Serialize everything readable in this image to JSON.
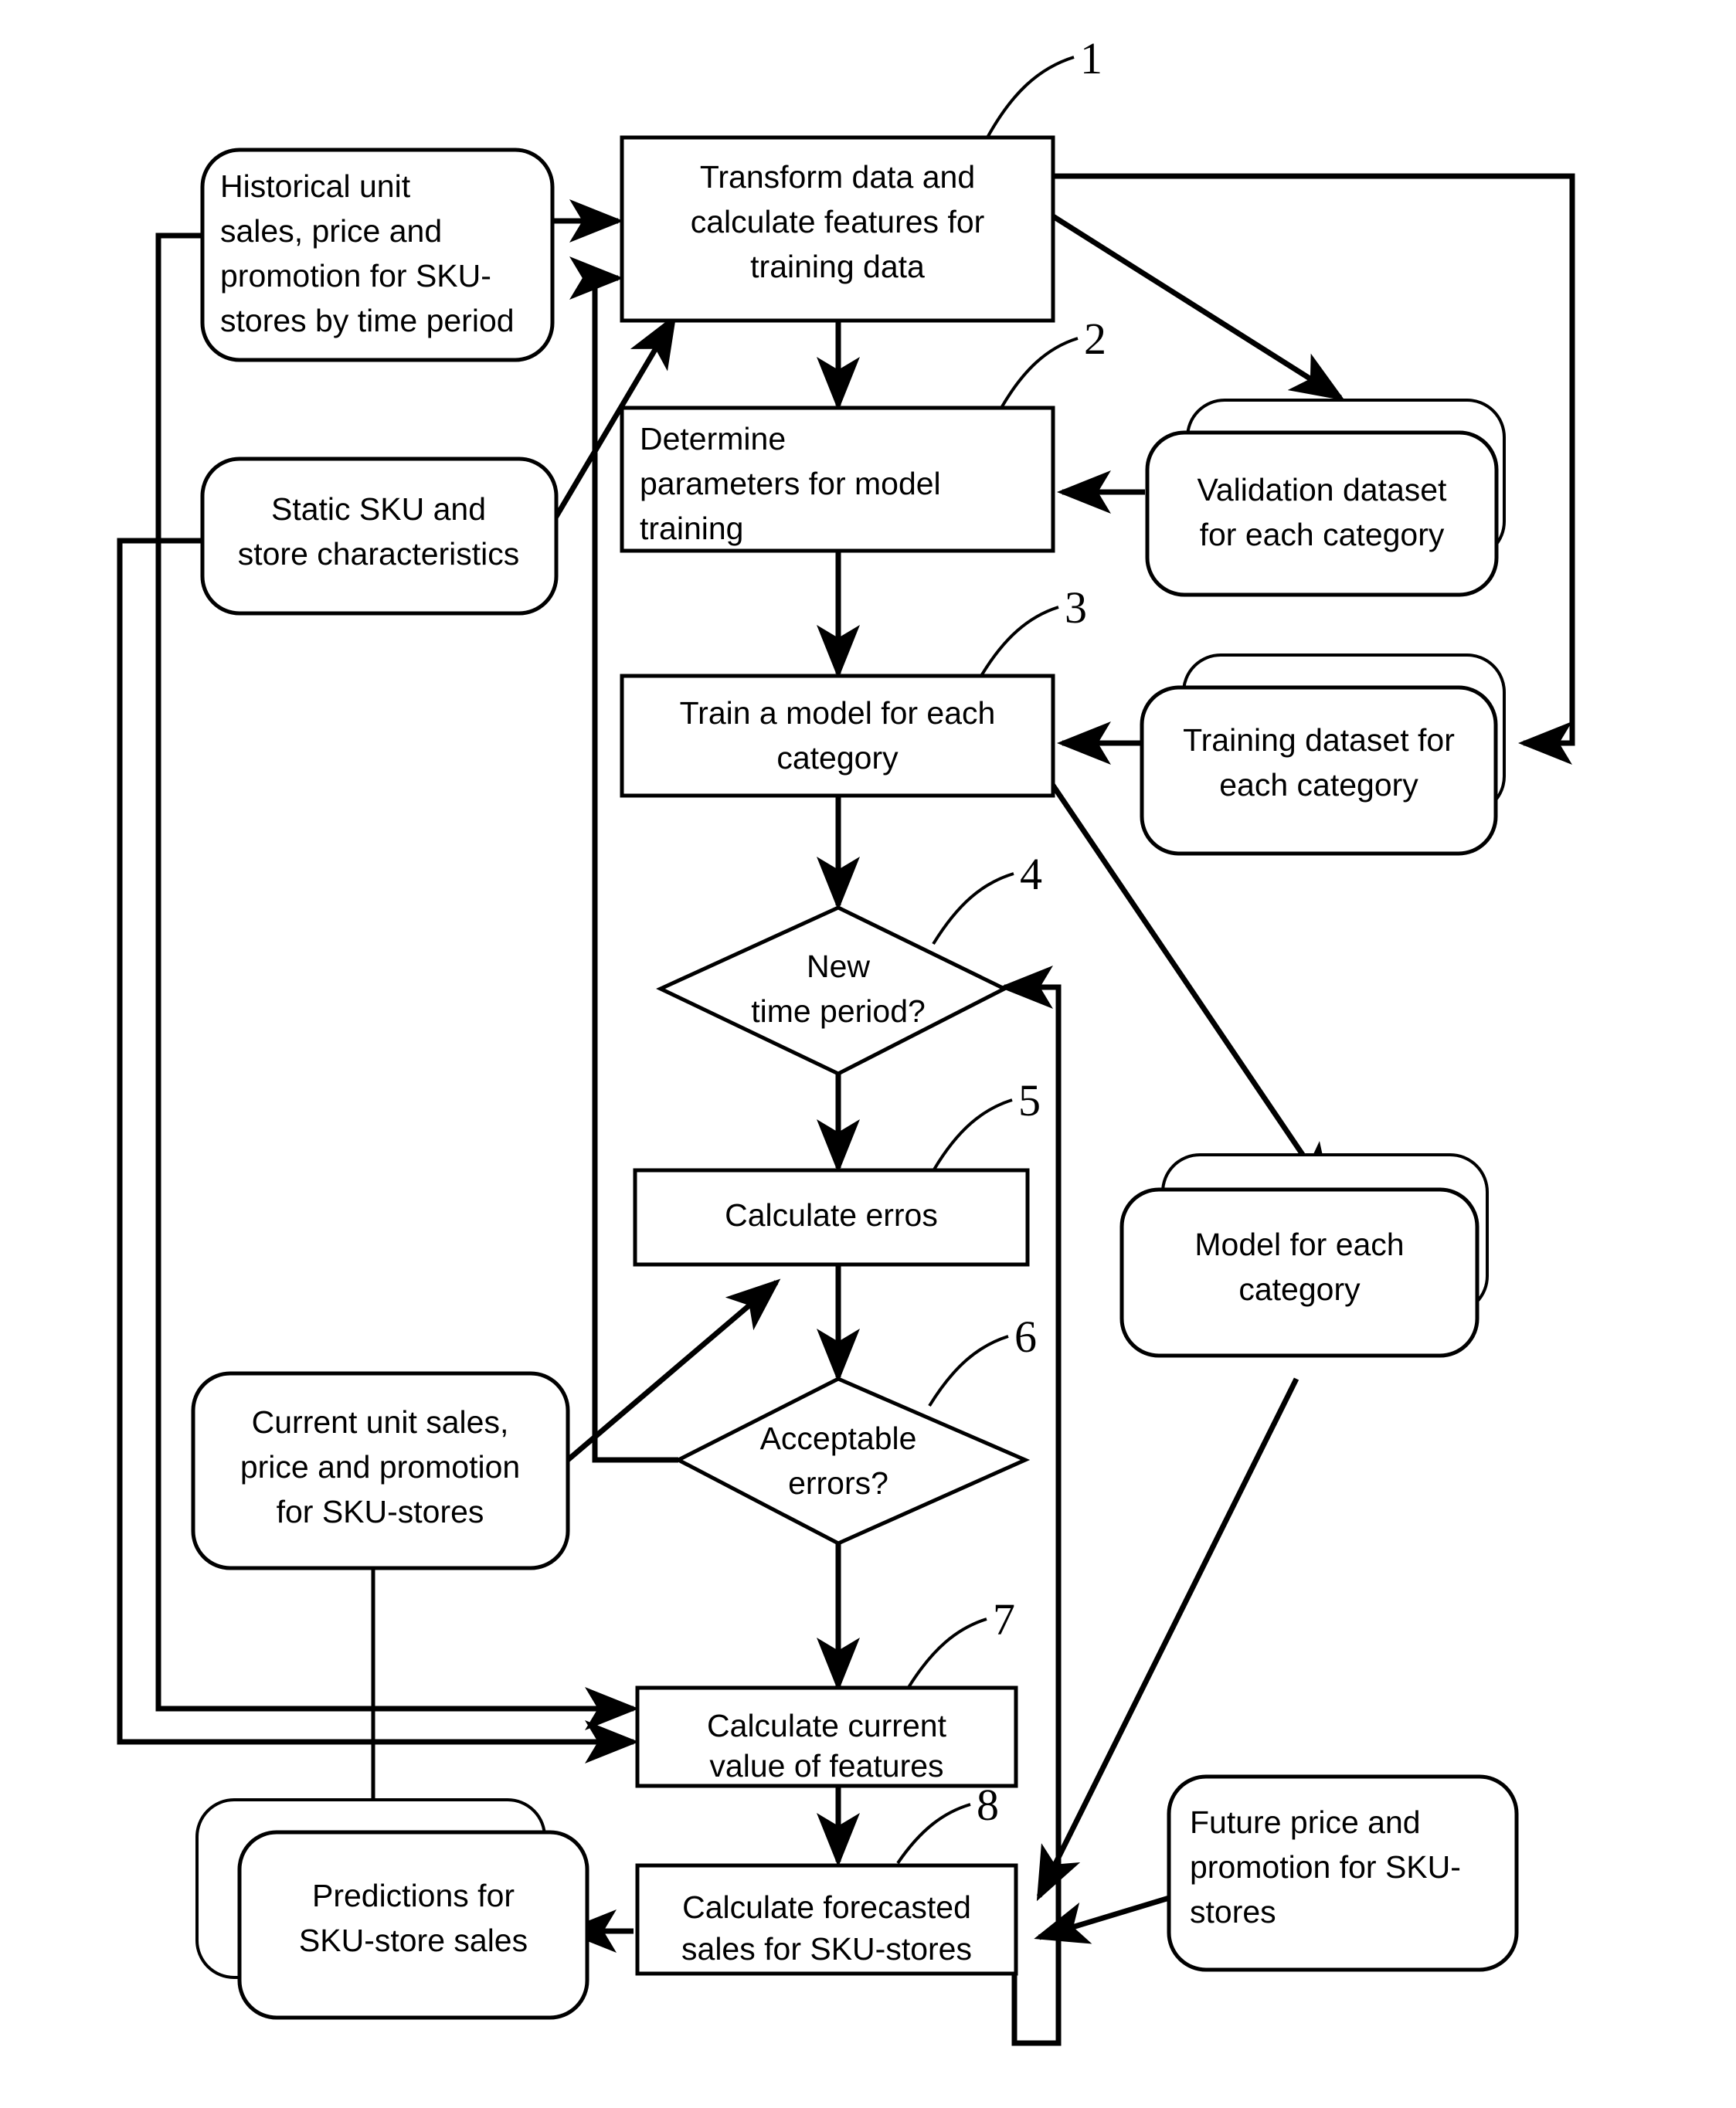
{
  "diagram": {
    "title": "SKU-store sales forecasting process flowchart",
    "stroke_color": "#000000",
    "fill_color": "#ffffff"
  },
  "nodes": {
    "historical_data": {
      "id": "historical-data",
      "shape": "rounded-rect",
      "lines": [
        "Historical unit",
        "sales, price and",
        "promotion for SKU-",
        "stores by time period"
      ]
    },
    "static_characteristics": {
      "id": "static-characteristics",
      "shape": "rounded-rect",
      "lines": [
        "Static SKU and",
        "store characteristics"
      ]
    },
    "current_data": {
      "id": "current-data",
      "shape": "rounded-rect",
      "lines": [
        "Current unit sales,",
        "price and promotion",
        "for SKU-stores"
      ]
    },
    "future_price": {
      "id": "future-price",
      "shape": "rounded-rect",
      "lines": [
        "Future price and",
        "promotion for SKU-",
        "stores"
      ]
    },
    "predictions": {
      "id": "predictions",
      "shape": "stacked-rounded-rect",
      "lines": [
        "Predictions for",
        "SKU-store sales"
      ]
    },
    "validation_dataset": {
      "id": "validation-dataset",
      "shape": "stacked-rounded-rect",
      "lines": [
        "Validation dataset",
        "for each category"
      ]
    },
    "training_dataset": {
      "id": "training-dataset",
      "shape": "stacked-rounded-rect",
      "lines": [
        "Training dataset for",
        "each category"
      ]
    },
    "model_each_category": {
      "id": "model-for-each-category",
      "shape": "stacked-rounded-rect",
      "lines": [
        "Model for each",
        "category"
      ]
    },
    "step1": {
      "id": "transform-data",
      "shape": "rect",
      "step_number": "1",
      "lines": [
        "Transform data and",
        "calculate features for",
        "training data"
      ]
    },
    "step2": {
      "id": "determine-parameters",
      "shape": "rect",
      "step_number": "2",
      "lines": [
        "Determine",
        "parameters for model",
        "training"
      ]
    },
    "step3": {
      "id": "train-model",
      "shape": "rect",
      "step_number": "3",
      "lines": [
        "Train a model for each",
        "category"
      ]
    },
    "step4": {
      "id": "new-time-period",
      "shape": "diamond",
      "step_number": "4",
      "lines": [
        "New",
        "time period?"
      ]
    },
    "step5": {
      "id": "calculate-errors",
      "shape": "rect",
      "step_number": "5",
      "lines": [
        "Calculate erros"
      ]
    },
    "step6": {
      "id": "acceptable-errors",
      "shape": "diamond",
      "step_number": "6",
      "lines": [
        "Acceptable",
        "errors?"
      ]
    },
    "step7": {
      "id": "calculate-current-features",
      "shape": "rect",
      "step_number": "7",
      "lines": [
        "Calculate current",
        "value of features"
      ]
    },
    "step8": {
      "id": "calculate-forecasted-sales",
      "shape": "rect",
      "step_number": "8",
      "lines": [
        "Calculate forecasted",
        "sales for SKU-stores"
      ]
    }
  },
  "step_numbers": [
    "1",
    "2",
    "3",
    "4",
    "5",
    "6",
    "7",
    "8"
  ],
  "edges": [
    {
      "from": "historical_data",
      "to": "step1"
    },
    {
      "from": "static_characteristics",
      "to": "step1"
    },
    {
      "from": "step1",
      "to": "step2"
    },
    {
      "from": "step1",
      "to": "validation_dataset"
    },
    {
      "from": "step1",
      "to": "training_dataset"
    },
    {
      "from": "validation_dataset",
      "to": "step2"
    },
    {
      "from": "step2",
      "to": "step3"
    },
    {
      "from": "training_dataset",
      "to": "step3"
    },
    {
      "from": "step3",
      "to": "step4"
    },
    {
      "from": "step3",
      "to": "model_each_category"
    },
    {
      "from": "step4",
      "to": "step5"
    },
    {
      "from": "current_data",
      "to": "step5"
    },
    {
      "from": "step5",
      "to": "step6"
    },
    {
      "from": "step6",
      "to": "step1"
    },
    {
      "from": "step6",
      "to": "step7"
    },
    {
      "from": "historical_data",
      "to": "step7"
    },
    {
      "from": "static_characteristics",
      "to": "step7"
    },
    {
      "from": "current_data",
      "to": "step7"
    },
    {
      "from": "step7",
      "to": "step8"
    },
    {
      "from": "model_each_category",
      "to": "step8"
    },
    {
      "from": "future_price",
      "to": "step8"
    },
    {
      "from": "step8",
      "to": "predictions"
    },
    {
      "from": "step8",
      "to": "step4"
    }
  ]
}
